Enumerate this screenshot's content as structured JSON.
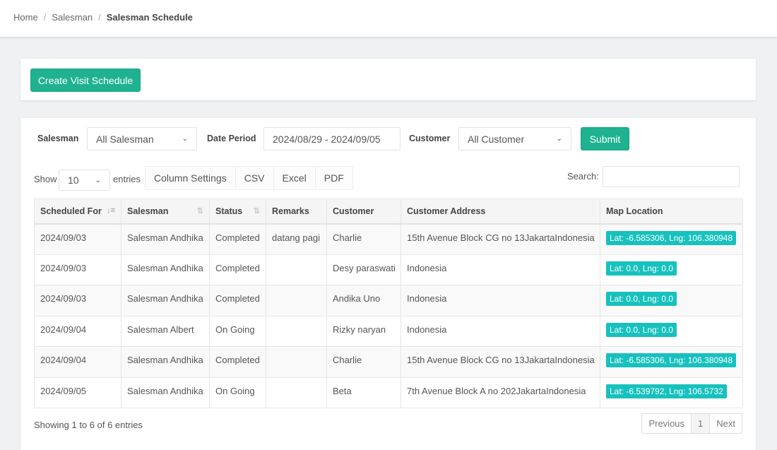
{
  "breadcrumb": [
    "Home",
    "Salesman",
    "Salesman Schedule"
  ],
  "create_button": "Create Visit Schedule",
  "filters": {
    "salesman_label": "Salesman",
    "salesman_value": "All Salesman",
    "date_label": "Date Period",
    "date_value": "2024/08/29 - 2024/09/05",
    "customer_label": "Customer",
    "customer_value": "All Customer",
    "submit": "Submit"
  },
  "table_controls": {
    "show": "Show",
    "length": "10",
    "entries": "entries",
    "buttons": [
      "Column Settings",
      "CSV",
      "Excel",
      "PDF"
    ],
    "search_label": "Search:",
    "search_value": ""
  },
  "columns": [
    "Scheduled For",
    "Salesman",
    "Status",
    "Remarks",
    "Customer",
    "Customer Address",
    "Map Location"
  ],
  "rows": [
    [
      "2024/09/03",
      "Salesman Andhika",
      "Completed",
      "datang pagi",
      "Charlie",
      "15th Avenue Block CG no 13JakartaIndonesia",
      "Lat: -6.585306, Lng: 106.380948"
    ],
    [
      "2024/09/03",
      "Salesman Andhika",
      "Completed",
      "",
      "Desy paraswati",
      "Indonesia",
      "Lat: 0.0, Lng: 0.0"
    ],
    [
      "2024/09/03",
      "Salesman Andhika",
      "Completed",
      "",
      "Andika Uno",
      "Indonesia",
      "Lat: 0.0, Lng: 0.0"
    ],
    [
      "2024/09/04",
      "Salesman Albert",
      "On Going",
      "",
      "Rizky naryan",
      "Indonesia",
      "Lat: 0.0, Lng: 0.0"
    ],
    [
      "2024/09/04",
      "Salesman Andhika",
      "Completed",
      "",
      "Charlie",
      "15th Avenue Block CG no 13JakartaIndonesia",
      "Lat: -6.585306, Lng: 106.380948"
    ],
    [
      "2024/09/05",
      "Salesman Andhika",
      "On Going",
      "",
      "Beta",
      "7th Avenue Block A no 202JakartaIndonesia",
      "Lat: -6.539792, Lng: 106.5732"
    ]
  ],
  "footer": {
    "info": "Showing 1 to 6 of 6 entries",
    "previous": "Previous",
    "page": "1",
    "next": "Next"
  },
  "colors": {
    "primary": "#1fb290",
    "badge": "#17c1bd"
  }
}
